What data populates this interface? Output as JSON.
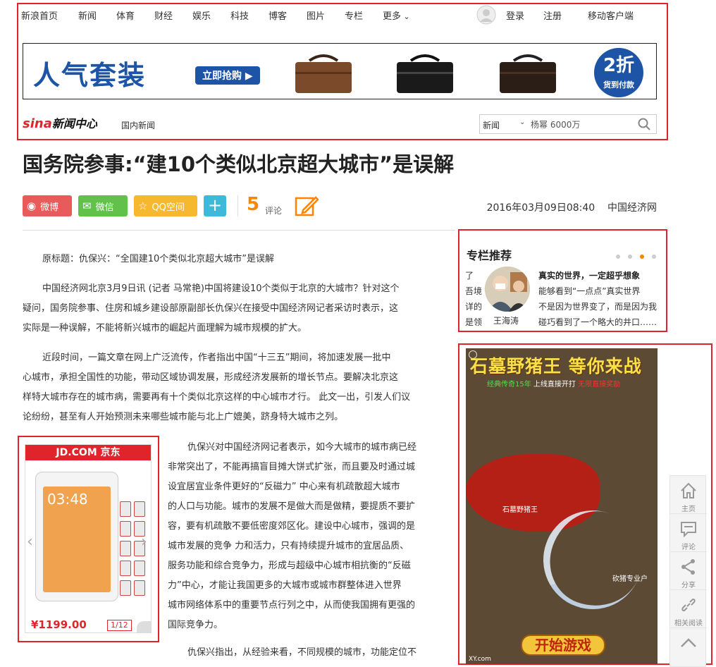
{
  "topnav": {
    "items": [
      "新浪首页",
      "新闻",
      "体育",
      "财经",
      "娱乐",
      "科技",
      "博客",
      "图片",
      "专栏",
      "更多"
    ],
    "login": "登录",
    "register": "注册",
    "mobile": "移动客户端"
  },
  "banner": {
    "headline": "人气套装",
    "cta": "立即抢购 ▶",
    "discount": "2折",
    "discount_sub": "货到付款"
  },
  "header": {
    "logo_sina": "sina",
    "logo_text": "新闻中心",
    "breadcrumb": "国内新闻",
    "search_category": "新闻",
    "search_query": "杨幂 6000万"
  },
  "article": {
    "title": "国务院参事:“建10个类似北京超大城市”是误解",
    "date": "2016年03月09日08:40",
    "source": "中国经济网",
    "comment_count": "5",
    "comment_label": "评论",
    "share": {
      "weibo": "微博",
      "wechat": "微信",
      "qzone": "QQ空间"
    },
    "p1": "原标题：仇保兴：“全国建10个类似北京超大城市”是误解",
    "p2": [
      "中国经济网北京3月9日讯 (记者 马常艳)中国将建设10个类似于北京的大城市？针对这个",
      "疑问，国务院参事、住房和城乡建设部原副部长仇保兴在接受中国经济网记者采访时表示，这",
      "实际是一种误解，不能将新兴城市的崛起片面理解为城市规模的扩大。"
    ],
    "p3": [
      "近段时间，一篇文章在网上广泛流传，作者指出中国“十三五”期间，将加速发展一批中",
      "心城市，承担全国性的功能，带动区域协调发展，形成经济发展新的增长节点。要解决北京这",
      "样特大城市存在的城市病，需要再有十个类似北京这样的中心城市才行。  此文一出，引发人们议",
      "论纷纷，甚至有人开始预测未来哪些城市能与北上广媲美，跻身特大城市之列。"
    ],
    "p4": [
      "仇保兴对中国经济网记者表示，如今大城市的城市病已经",
      "非常突出了，不能再搞盲目摊大饼式扩张，而且要及时通过城",
      "设宜居宜业条件更好的“反磁力” 中心来有机疏散超大城市",
      "的人口与功能。城市的发展不是做大而是做精，要提质不要扩",
      "容，要有机疏散不要低密度郊区化。建设中心城市，强调的是",
      "城市发展的竞争 力和活力，只有持续提升城市的宜居品质、",
      "服务功能和综合竞争力，形成与超级中心城市相抗衡的“反磁",
      "力”中心，才能让我国更多的大城市或城市群整体进入世界",
      "城市网络体系中的重要节点行列之中，从而使我国拥有更强的",
      "国际竞争力。"
    ],
    "p5": "仇保兴指出，从经验来看，不同规模的城市，功能定位不"
  },
  "jd_ad": {
    "header": "JD.COM 京东",
    "clock": "03:48",
    "price": "¥1199.00",
    "page": "1/12"
  },
  "column": {
    "title": "专栏推荐",
    "frag": [
      "了",
      "吾境",
      "详的",
      "是领"
    ],
    "author": "王海涛",
    "text": [
      "真实的世界，一定超乎想象",
      "能够看到“一点点”真实世界",
      "不是因为世界变了，而是因为我",
      "碰巧看到了一个略大的井口……"
    ]
  },
  "game_ad": {
    "title": "石墓野猪王  等你来战",
    "sub_green": "经典传奇15年",
    "sub_white": "上线直接开打",
    "sub_red": "无限直接奖励",
    "monster_label": "石墓野猪王",
    "player_label": "砍猪专业户",
    "start": "开始游戏",
    "site": "XY.com"
  },
  "floatbar": {
    "home": "主页",
    "comment": "评论",
    "share": "分享",
    "related": "相关阅读"
  },
  "colors": {
    "accent_red": "#e0242b",
    "sina_blue": "#1d54a6",
    "orange": "#ff8400"
  }
}
